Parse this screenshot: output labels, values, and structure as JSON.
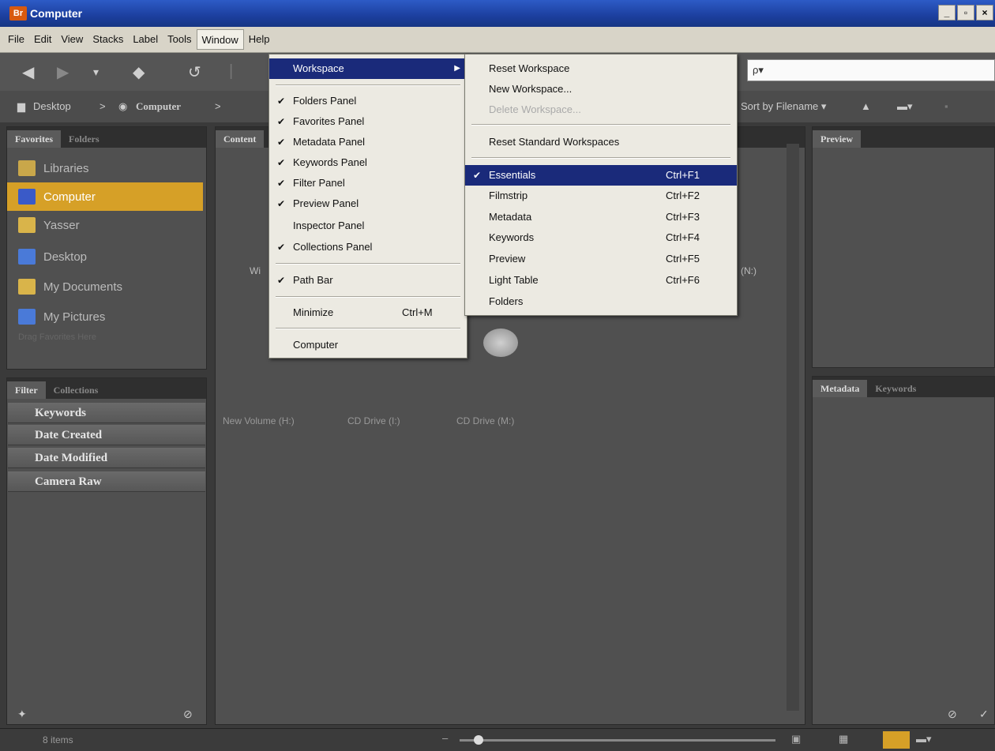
{
  "window": {
    "app_badge": "Br",
    "title": "Computer",
    "min": "_",
    "max": "▫",
    "close": "×"
  },
  "menubar": [
    "File",
    "Edit",
    "View",
    "Stacks",
    "Label",
    "Tools",
    "Window",
    "Help"
  ],
  "search": {
    "placeholder": "ρ▾"
  },
  "path": {
    "crumb1": "Desktop",
    "sep": ">",
    "crumb2": "Computer",
    "sep2": ">"
  },
  "sort": {
    "label": "Sort by Filename ▾"
  },
  "left_top_tabs": [
    "Favorites",
    "Folders"
  ],
  "favorites": [
    {
      "label": "Libraries",
      "icon": "libraries-icon",
      "color": "#c9a74a"
    },
    {
      "label": "Computer",
      "icon": "computer-icon",
      "color": "#3a5ac8"
    },
    {
      "label": "Yasser",
      "icon": "user-folder-icon",
      "color": "#d9b44a"
    },
    {
      "label": "Desktop",
      "icon": "desktop-icon",
      "color": "#4a7ad8"
    },
    {
      "label": "My Documents",
      "icon": "documents-icon",
      "color": "#d9b44a"
    },
    {
      "label": "My Pictures",
      "icon": "pictures-icon",
      "color": "#4a7ad8"
    }
  ],
  "favorites_hint": "Drag Favorites Here",
  "left_bottom_tabs": [
    "Filter",
    "Collections"
  ],
  "filters": [
    "Keywords",
    "Date Created",
    "Date Modified",
    "Camera Raw"
  ],
  "content_tab": "Content",
  "drives": [
    "New Volume (H:)",
    "CD Drive (I:)",
    "CD Drive (M:)"
  ],
  "content_partial": {
    "left": "Wi",
    "right": "(N:)"
  },
  "right_top_tab": "Preview",
  "right_bottom_tabs": [
    "Metadata",
    "Keywords"
  ],
  "status": {
    "items": "8 items"
  },
  "window_menu": {
    "items": [
      {
        "label": "Workspace",
        "checked": false,
        "submenu": true
      },
      {
        "label": "Folders Panel",
        "checked": true
      },
      {
        "label": "Favorites Panel",
        "checked": true
      },
      {
        "label": "Metadata Panel",
        "checked": true
      },
      {
        "label": "Keywords Panel",
        "checked": true
      },
      {
        "label": "Filter Panel",
        "checked": true
      },
      {
        "label": "Preview Panel",
        "checked": true
      },
      {
        "label": "Inspector Panel",
        "checked": false
      },
      {
        "label": "Collections Panel",
        "checked": true
      },
      {
        "label": "Path Bar",
        "checked": true
      },
      {
        "label": "Minimize",
        "shortcut": "Ctrl+M"
      },
      {
        "label": "Computer"
      }
    ]
  },
  "workspace_menu": {
    "items": [
      {
        "label": "Reset Workspace"
      },
      {
        "label": "New Workspace..."
      },
      {
        "label": "Delete Workspace..."
      },
      {
        "label": "Reset Standard Workspaces"
      },
      {
        "label": "Essentials",
        "shortcut": "Ctrl+F1",
        "checked": true
      },
      {
        "label": "Filmstrip",
        "shortcut": "Ctrl+F2"
      },
      {
        "label": "Metadata",
        "shortcut": "Ctrl+F3"
      },
      {
        "label": "Keywords",
        "shortcut": "Ctrl+F4"
      },
      {
        "label": "Preview",
        "shortcut": "Ctrl+F5"
      },
      {
        "label": "Light Table",
        "shortcut": "Ctrl+F6"
      },
      {
        "label": "Folders"
      }
    ]
  },
  "check_glyph": "✔",
  "arrow_glyph": "▶"
}
